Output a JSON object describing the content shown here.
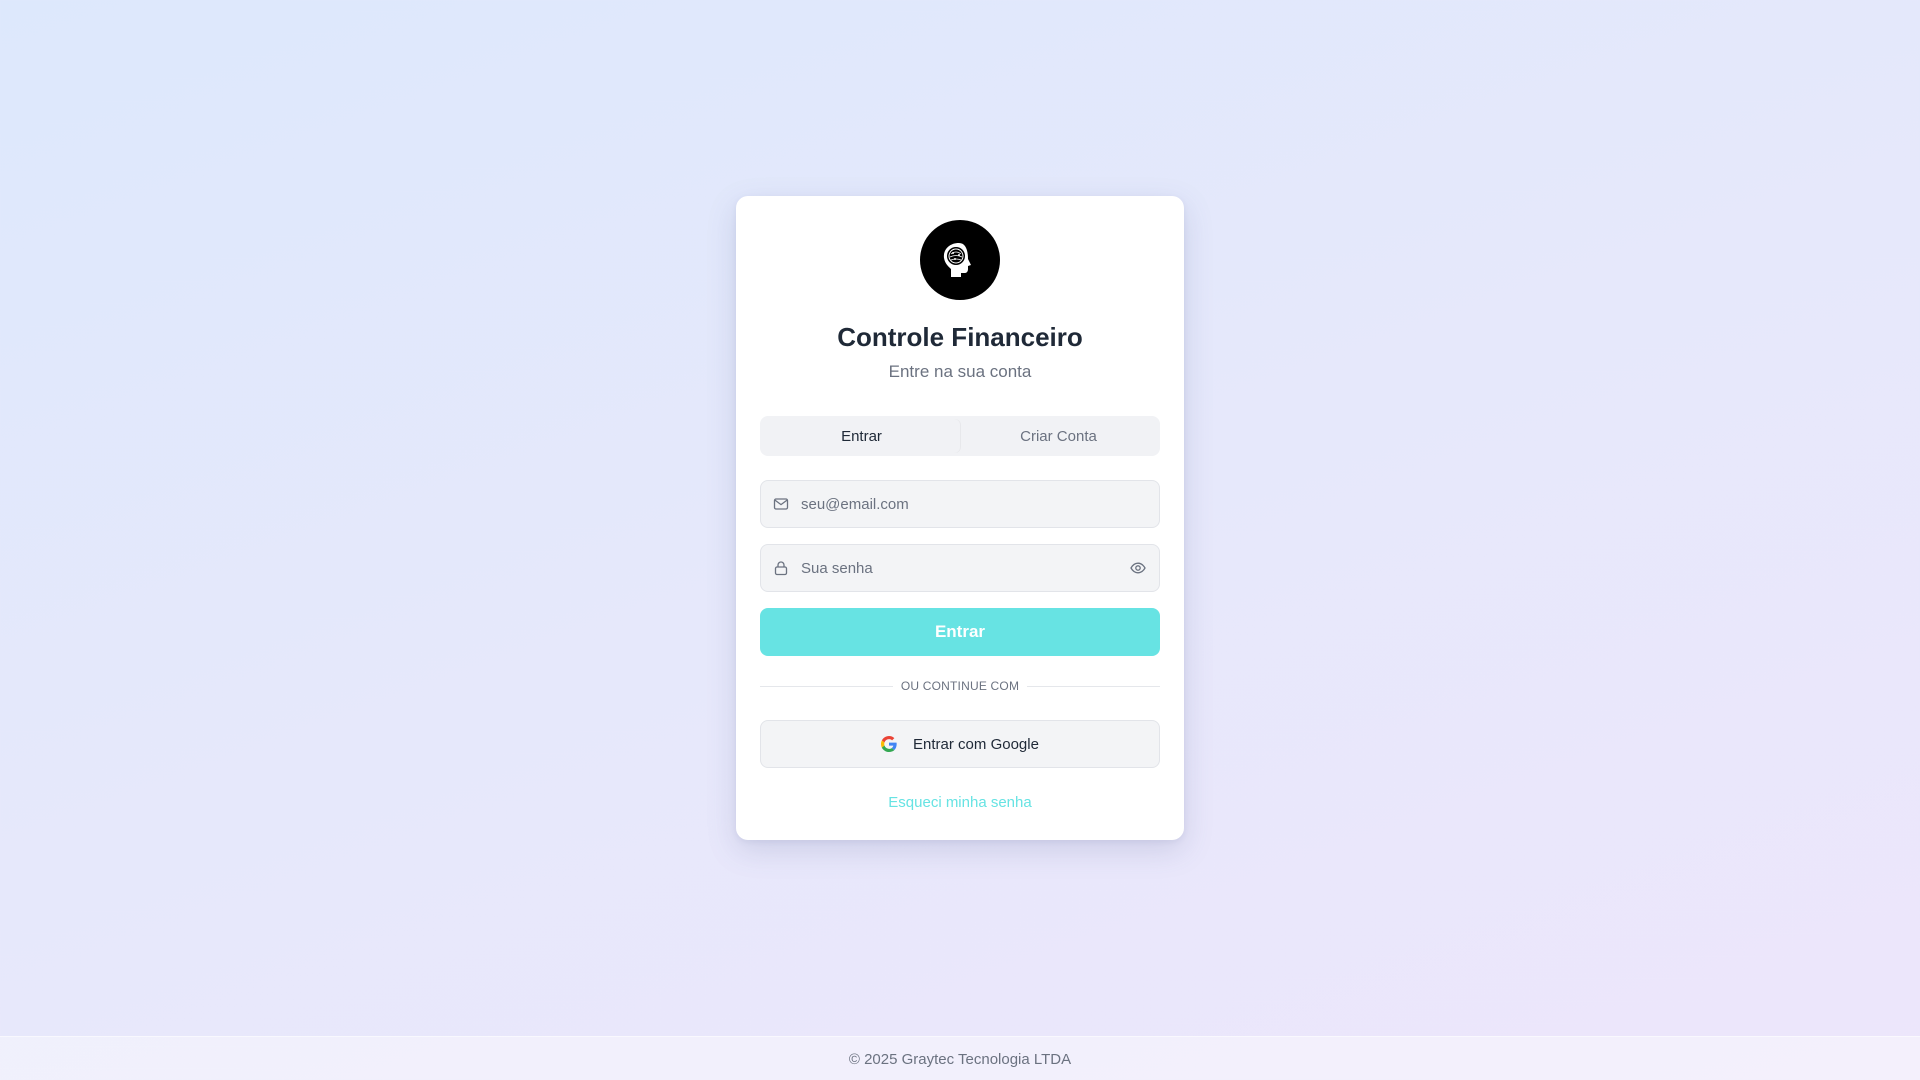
{
  "brand": {
    "logo_icon": "head-silhouette-icon",
    "title": "Controle Financeiro",
    "subtitle": "Entre na sua conta"
  },
  "tabs": [
    {
      "label": "Entrar",
      "active": true
    },
    {
      "label": "Criar Conta",
      "active": false
    }
  ],
  "form": {
    "email": {
      "placeholder": "seu@email.com",
      "value": "",
      "icon": "mail-icon"
    },
    "password": {
      "placeholder": "Sua senha",
      "value": "",
      "icon": "lock-icon",
      "toggle_icon": "eye-icon"
    },
    "submit_label": "Entrar"
  },
  "divider_text": "OU CONTINUE COM",
  "google_button": {
    "label": "Entrar com Google",
    "icon": "google-icon"
  },
  "forgot_password": "Esqueci minha senha",
  "footer": "© 2025 Graytec Tecnologia LTDA",
  "colors": {
    "accent": "#67e3e3",
    "card_background": "#ffffff",
    "text_primary": "#1f2937",
    "text_muted": "#6b7280"
  }
}
